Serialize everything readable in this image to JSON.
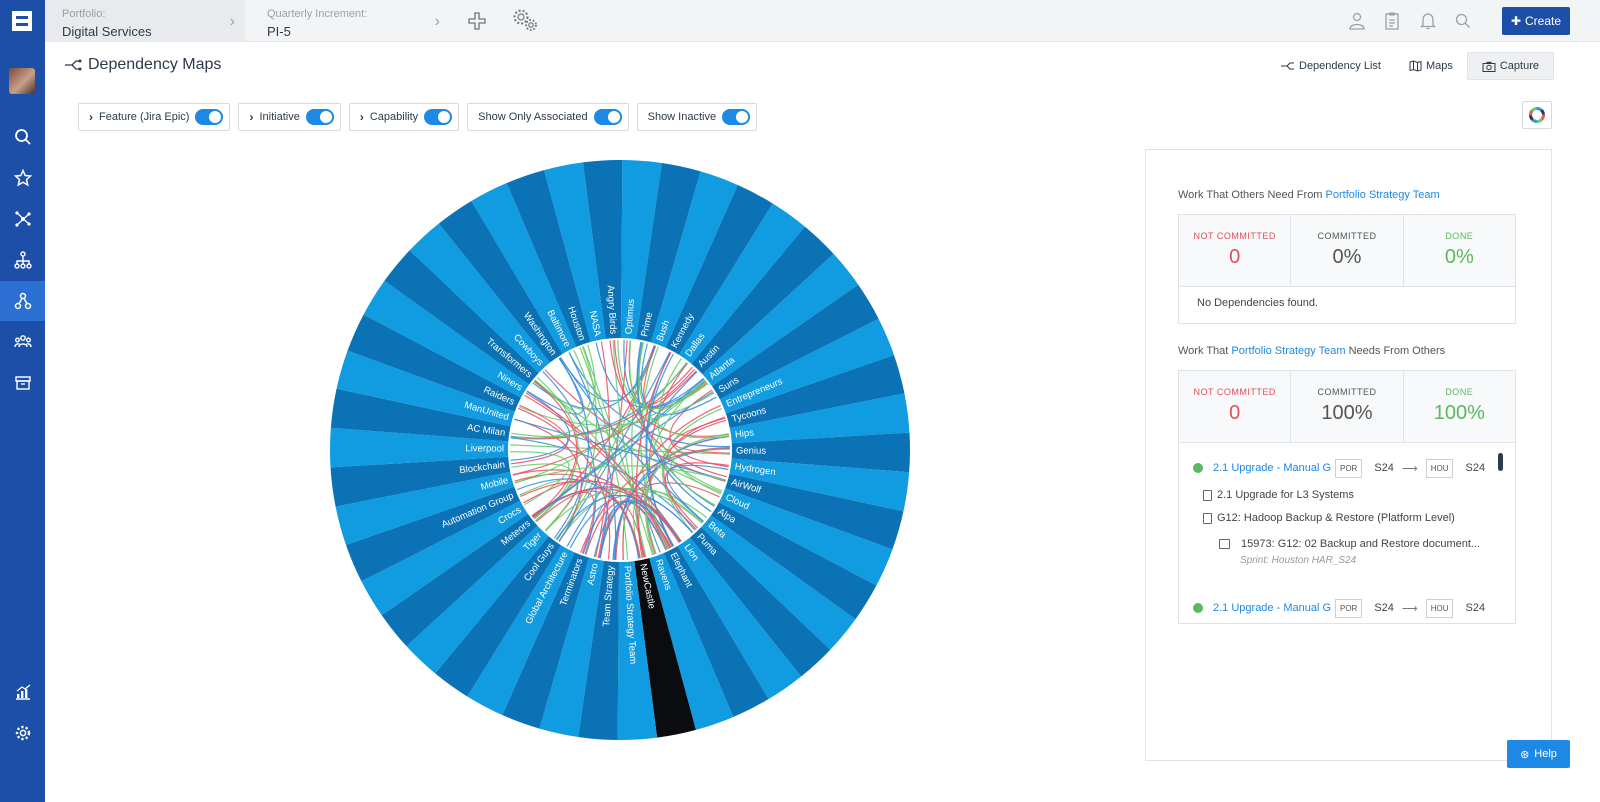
{
  "topbar": {
    "portfolio_label": "Portfolio:",
    "portfolio_value": "Digital Services",
    "increment_label": "Quarterly Increment:",
    "increment_value": "PI-5",
    "create_label": "Create"
  },
  "page": {
    "title": "Dependency Maps",
    "links": {
      "dependency_list": "Dependency List",
      "maps": "Maps",
      "capture": "Capture"
    }
  },
  "toggles": [
    {
      "label": "Feature (Jira Epic)",
      "on": true,
      "caret": true
    },
    {
      "label": "Initiative",
      "on": true,
      "caret": true
    },
    {
      "label": "Capability",
      "on": true,
      "caret": true
    },
    {
      "label": "Show Only Associated",
      "on": true,
      "caret": false
    },
    {
      "label": "Show Inactive",
      "on": true,
      "caret": false
    }
  ],
  "chord": {
    "colors": {
      "dark": "#0a72b5",
      "light": "#119be0",
      "selected": "#0a0c10",
      "red": "#e8546a",
      "green": "#6ccc6c",
      "blue": "#3b8fe0"
    },
    "teams": [
      "Angry Birds",
      "Optimus",
      "Prime",
      "Bush",
      "Kennedy",
      "Dallas",
      "Austin",
      "Atlanta",
      "Suns",
      "Entrepreneurs",
      "Tycoons",
      "Hips",
      "Genius",
      "Hydrogen",
      "AirWolf",
      "Cloud",
      "Alpa",
      "Beta",
      "Puma",
      "Lion",
      "Elephant",
      "Ravens",
      "NewCastle",
      "Portfolio Strategy Team",
      "Team Strategy",
      "Astro",
      "Terminators",
      "Global Architecture",
      "Cool Guys",
      "Tiger",
      "Meteors",
      "Crocs",
      "Automation Group",
      "Mobile",
      "Blockchain",
      "Liverpool",
      "AC Milan",
      "ManUnited",
      "Raiders",
      "Niners",
      "Transformers",
      "Cowboys",
      "Washington",
      "Baltimore",
      "Houston",
      "NASA"
    ],
    "selected": "NewCastle"
  },
  "panel": {
    "section1": {
      "prefix": "Work That Others Need From ",
      "team": "Portfolio Strategy Team",
      "suffix": "",
      "not_committed_label": "NOT COMMITTED",
      "not_committed": "0",
      "committed_label": "COMMITTED",
      "committed": "0%",
      "done_label": "DONE",
      "done": "0%",
      "empty": "No Dependencies found."
    },
    "section2": {
      "prefix": "Work That ",
      "team": "Portfolio Strategy Team",
      "suffix": " Needs From Others",
      "not_committed_label": "NOT COMMITTED",
      "not_committed": "0",
      "committed_label": "COMMITTED",
      "committed": "100%",
      "done_label": "DONE",
      "done": "100%"
    },
    "dependencies": [
      {
        "title": "2.1 Upgrade - Manual G",
        "from_tag": "POR",
        "from_sprint": "S24",
        "to_tag": "HOU",
        "to_sprint": "S24"
      },
      {
        "title": "2.1 Upgrade - Manual G",
        "from_tag": "POR",
        "from_sprint": "S24",
        "to_tag": "HOU",
        "to_sprint": "S24"
      }
    ],
    "sub_items": {
      "item1": "2.1 Upgrade for L3 Systems",
      "item2": "G12: Hadoop Backup & Restore (Platform Level)",
      "item3": "15973: G12: 02 Backup and Restore document...",
      "sprint_note": "Sprint: Houston HAR_S24"
    }
  },
  "help_label": "Help"
}
